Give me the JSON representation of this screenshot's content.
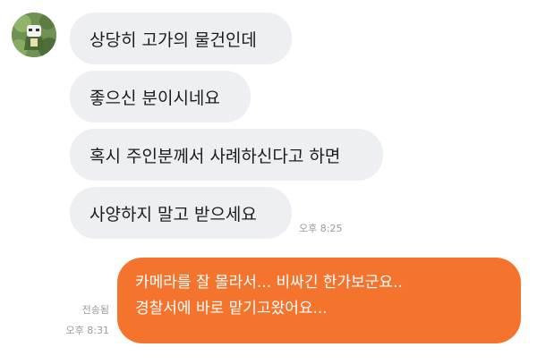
{
  "conversation": {
    "incoming_messages": [
      "상당히 고가의 물건인데",
      "좋으신 분이시네요",
      "혹시 주인분께서 사례하신다고 하면",
      "사양하지 말고 받으세요"
    ],
    "incoming_time": "오후 8:25",
    "outgoing_message_lines": [
      "카메라를 잘 몰라서... 비싸긴 한가보군요..",
      "경찰서에 바로 맡기고왔어요..."
    ],
    "outgoing_status": "전송됨",
    "outgoing_time": "오후 8:31"
  },
  "colors": {
    "incoming_bubble": "#eeeff3",
    "outgoing_bubble": "#f4742e",
    "timestamp_text": "#9a9a9a"
  },
  "icons": {
    "avatar": "profile-avatar-icon"
  }
}
